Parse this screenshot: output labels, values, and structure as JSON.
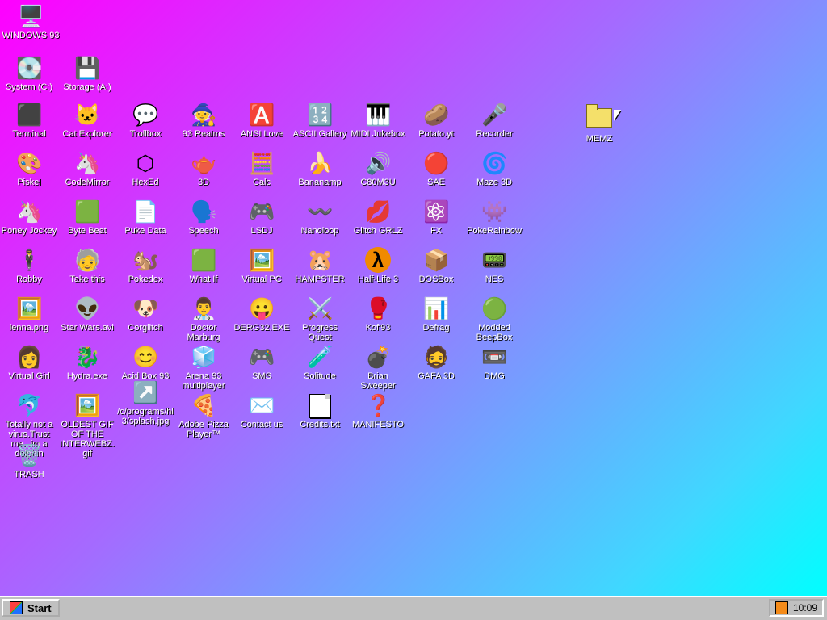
{
  "desktop": {
    "icons": [
      {
        "label": "WINDOWS 93",
        "glyph": "🖥️"
      },
      {
        "label": "System (C:)",
        "glyph": "💽"
      },
      {
        "label": "Storage (A:)",
        "glyph": "💾"
      },
      {
        "label": "Terminal",
        "glyph": "⬛"
      },
      {
        "label": "Cat Explorer",
        "glyph": "🐱"
      },
      {
        "label": "Trollbox",
        "glyph": "💬"
      },
      {
        "label": "93 Realms",
        "glyph": "🧙"
      },
      {
        "label": "ANSI Love",
        "glyph": "🅰️"
      },
      {
        "label": "ASCII Gallery",
        "glyph": "🔢"
      },
      {
        "label": "MIDI Jukebox",
        "glyph": "🎹"
      },
      {
        "label": "Potato.yt",
        "glyph": "🥔"
      },
      {
        "label": "Recorder",
        "glyph": "🎤"
      },
      {
        "label": "MEMZ",
        "glyph": ""
      },
      {
        "label": "Piskel",
        "glyph": "🎨"
      },
      {
        "label": "CodeMirror",
        "glyph": "🦄"
      },
      {
        "label": "HexEd",
        "glyph": "⬡"
      },
      {
        "label": "3D",
        "glyph": "🫖"
      },
      {
        "label": "Calc",
        "glyph": "🧮"
      },
      {
        "label": "Bananamp",
        "glyph": "🍌"
      },
      {
        "label": "C80M3U",
        "glyph": "🔊"
      },
      {
        "label": "SAE",
        "glyph": "🔴"
      },
      {
        "label": "Maze 3D",
        "glyph": "🌀"
      },
      {
        "label": "Poney Jockey",
        "glyph": "🦄"
      },
      {
        "label": "Byte Beat",
        "glyph": "🟩"
      },
      {
        "label": "Puke Data",
        "glyph": "📄"
      },
      {
        "label": "Speech",
        "glyph": "🗣️"
      },
      {
        "label": "LSDJ",
        "glyph": "🎮"
      },
      {
        "label": "Nanoloop",
        "glyph": "〰️"
      },
      {
        "label": "Glitch GRLZ",
        "glyph": "💋"
      },
      {
        "label": "FX",
        "glyph": "⚛️"
      },
      {
        "label": "PokeRainbow",
        "glyph": "👾"
      },
      {
        "label": "Robby",
        "glyph": "🕴️"
      },
      {
        "label": "Take this",
        "glyph": "🧓"
      },
      {
        "label": "Pokedex",
        "glyph": "🐿️"
      },
      {
        "label": "What If",
        "glyph": "🟩"
      },
      {
        "label": "Virtual PC",
        "glyph": "🖼️"
      },
      {
        "label": "HAMPSTER",
        "glyph": "🐹"
      },
      {
        "label": "Half-Life 3",
        "glyph": "λ"
      },
      {
        "label": "DOSBox",
        "glyph": "📦"
      },
      {
        "label": "NES",
        "glyph": "📟"
      },
      {
        "label": "lenna.png",
        "glyph": "🖼️"
      },
      {
        "label": "Star Wars.avi",
        "glyph": "👽"
      },
      {
        "label": "Corglitch",
        "glyph": "🐶"
      },
      {
        "label": "Doctor Marburg",
        "glyph": "👨‍⚕️"
      },
      {
        "label": "DERG32.EXE",
        "glyph": "😛"
      },
      {
        "label": "Progress Quest",
        "glyph": "⚔️"
      },
      {
        "label": "Kof'93",
        "glyph": "🥊"
      },
      {
        "label": "Defrag",
        "glyph": "📊"
      },
      {
        "label": "Modded BeepBox",
        "glyph": "🟢"
      },
      {
        "label": "Virtual Girl",
        "glyph": "👩"
      },
      {
        "label": "Hydra.exe",
        "glyph": "🐉"
      },
      {
        "label": "Acid Box 93",
        "glyph": "😊"
      },
      {
        "label": "Arena 93 multiplayer",
        "glyph": "🧊"
      },
      {
        "label": "SMS",
        "glyph": "🎮"
      },
      {
        "label": "Solitude",
        "glyph": "🧪"
      },
      {
        "label": "Brian Sweeper",
        "glyph": "💣"
      },
      {
        "label": "GAFA 3D",
        "glyph": "🧔"
      },
      {
        "label": "DMG",
        "glyph": "📼"
      },
      {
        "label": "Totally not a virus.Trust me...im a dolphin",
        "glyph": "🐬"
      },
      {
        "label": "OLDEST GIF OF THE INTERWEBZ.gif",
        "glyph": "🖼️"
      },
      {
        "label": "/c/programs/hl3/splash.jpg",
        "glyph": "↗️"
      },
      {
        "label": "Adobe Pizza Player™",
        "glyph": "🍕"
      },
      {
        "label": "Contact us",
        "glyph": "✉️"
      },
      {
        "label": "Credits.txt",
        "glyph": ""
      },
      {
        "label": "MANIFESTO",
        "glyph": "❓"
      },
      {
        "label": "TRASH",
        "glyph": "🗑️"
      }
    ]
  },
  "taskbar": {
    "start_label": "Start",
    "clock": "10:09"
  }
}
